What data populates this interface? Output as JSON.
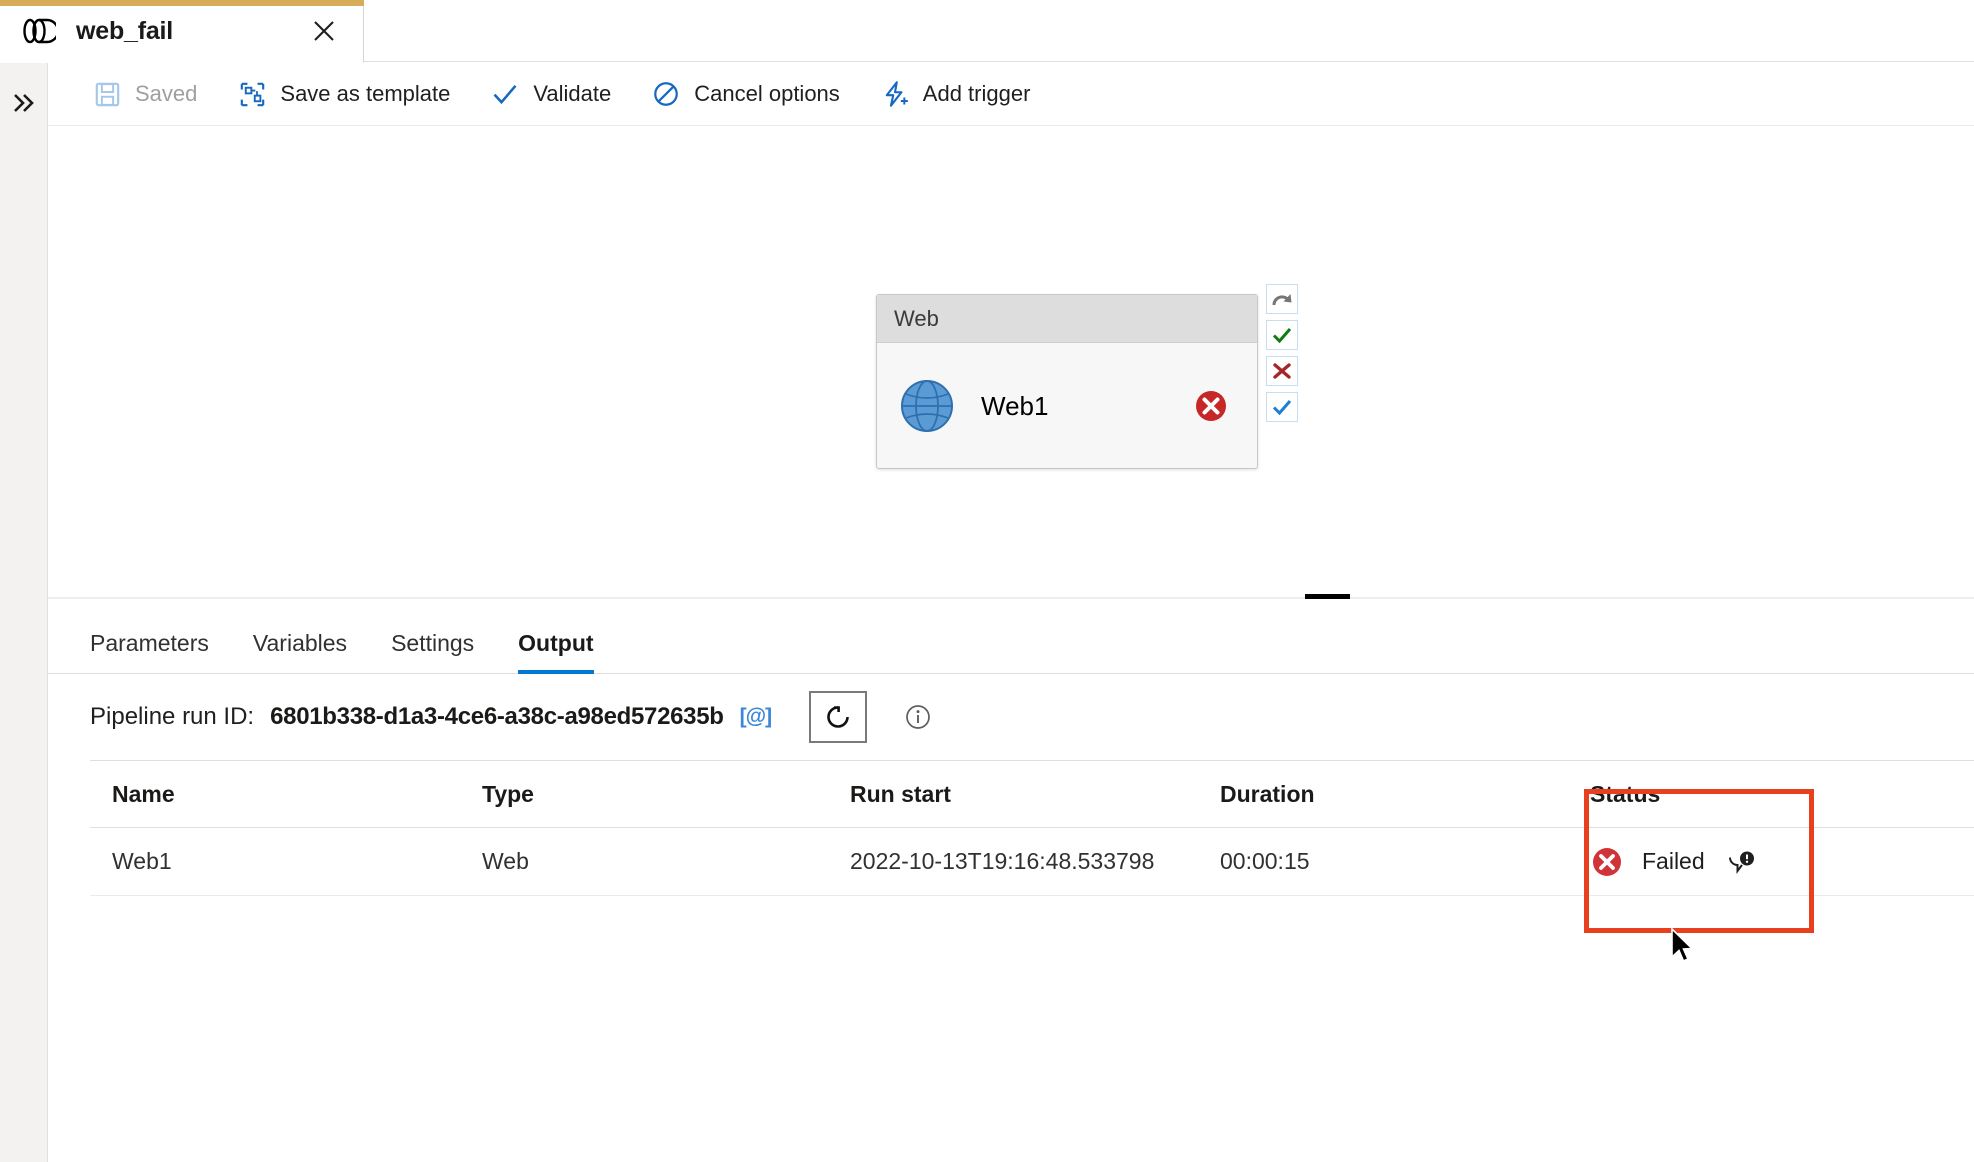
{
  "tab": {
    "title": "web_fail",
    "icon": "pipeline-icon",
    "close_label": "Close",
    "accent_color": "#d8ad5a"
  },
  "rail": {
    "expand_label": "»"
  },
  "commandbar": {
    "items": [
      {
        "label": "Saved",
        "icon": "save-icon",
        "disabled": true
      },
      {
        "label": "Save as template",
        "icon": "save-as-template-icon",
        "disabled": false
      },
      {
        "label": "Validate",
        "icon": "checkmark-icon",
        "disabled": false
      },
      {
        "label": "Cancel options",
        "icon": "cancel-circle-icon",
        "disabled": false
      },
      {
        "label": "Add trigger",
        "icon": "lightning-add-icon",
        "disabled": false
      }
    ]
  },
  "canvas": {
    "node": {
      "header": "Web",
      "name": "Web1",
      "activity_icon": "globe-icon",
      "status_icon": "error-circle-icon",
      "handles": [
        {
          "name": "handle-completion",
          "icon": "curved-arrow-icon",
          "color": "#767676"
        },
        {
          "name": "handle-success",
          "icon": "check-icon",
          "color": "#107c10"
        },
        {
          "name": "handle-failure",
          "icon": "cross-icon",
          "color": "#a4262c"
        },
        {
          "name": "handle-skipped",
          "icon": "check-icon",
          "color": "#0078d4"
        }
      ]
    }
  },
  "panel": {
    "tabs": [
      {
        "label": "Parameters",
        "active": false
      },
      {
        "label": "Variables",
        "active": false
      },
      {
        "label": "Settings",
        "active": false
      },
      {
        "label": "Output",
        "active": true
      }
    ],
    "run": {
      "label": "Pipeline run ID:",
      "id": "6801b338-d1a3-4ce6-a38c-a98ed572635b",
      "copy_icon": "[@]",
      "refresh_icon": "refresh-icon",
      "info_icon": "info-icon"
    },
    "table": {
      "columns": [
        "Name",
        "Type",
        "Run start",
        "Duration",
        "Status"
      ],
      "rows": [
        {
          "name": "Web1",
          "type": "Web",
          "run_start": "2022-10-13T19:16:48.533798",
          "duration": "00:00:15",
          "status": "Failed",
          "status_icon": "error-circle-icon",
          "message_icon": "error-message-icon"
        }
      ]
    }
  },
  "annotation": {
    "color": "#e8401f"
  }
}
